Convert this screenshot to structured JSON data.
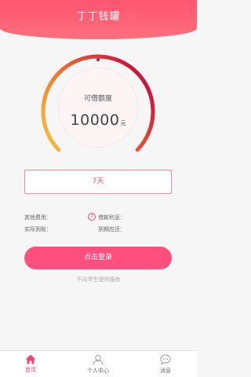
{
  "header": {
    "title": "丁丁钱罐"
  },
  "gauge": {
    "label": "可借额度",
    "amount": "10000",
    "unit": "元",
    "fill_fraction": 1.0
  },
  "term": {
    "label": "7天"
  },
  "info": {
    "fee_label": "其他费用：",
    "interest_label": "借款利息：",
    "actual_label": "实际到账：",
    "due_label": "到期应还："
  },
  "actions": {
    "submit_label": "点击登录"
  },
  "footnote": "不向学生提供服务",
  "tabs": [
    {
      "label": "首页",
      "icon": "home-icon",
      "active": true
    },
    {
      "label": "个人中心",
      "icon": "user-icon",
      "active": false
    },
    {
      "label": "消息",
      "icon": "message-icon",
      "active": false
    }
  ],
  "colors": {
    "brand": "#ff5572",
    "accent": "#e8496f",
    "gauge_start": "#f5c542",
    "gauge_end": "#c7173f"
  }
}
